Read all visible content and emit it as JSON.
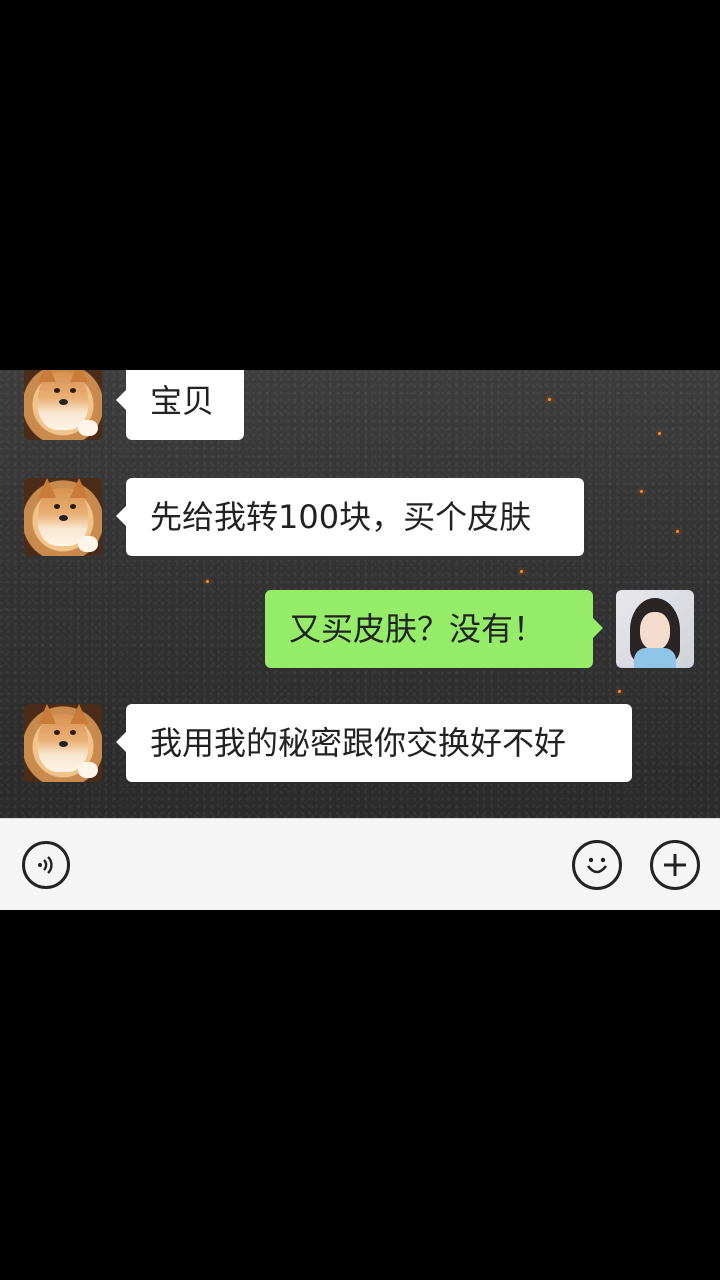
{
  "messages": [
    {
      "sender": "other",
      "text": "宝贝",
      "avatar": "shiba-dog-avatar"
    },
    {
      "sender": "other",
      "text": "先给我转100块，买个皮肤",
      "avatar": "shiba-dog-avatar"
    },
    {
      "sender": "self",
      "text": "又买皮肤？没有！",
      "avatar": "anime-girl-avatar"
    },
    {
      "sender": "other",
      "text": "我用我的秘密跟你交换好不好",
      "avatar": "shiba-dog-avatar"
    }
  ],
  "input_bar": {
    "voice_icon": "voice-icon",
    "emoji_icon": "emoji-icon",
    "plus_icon": "plus-icon"
  },
  "colors": {
    "self_bubble": "#95ec69",
    "other_bubble": "#ffffff",
    "input_bar": "#f5f5f5"
  }
}
